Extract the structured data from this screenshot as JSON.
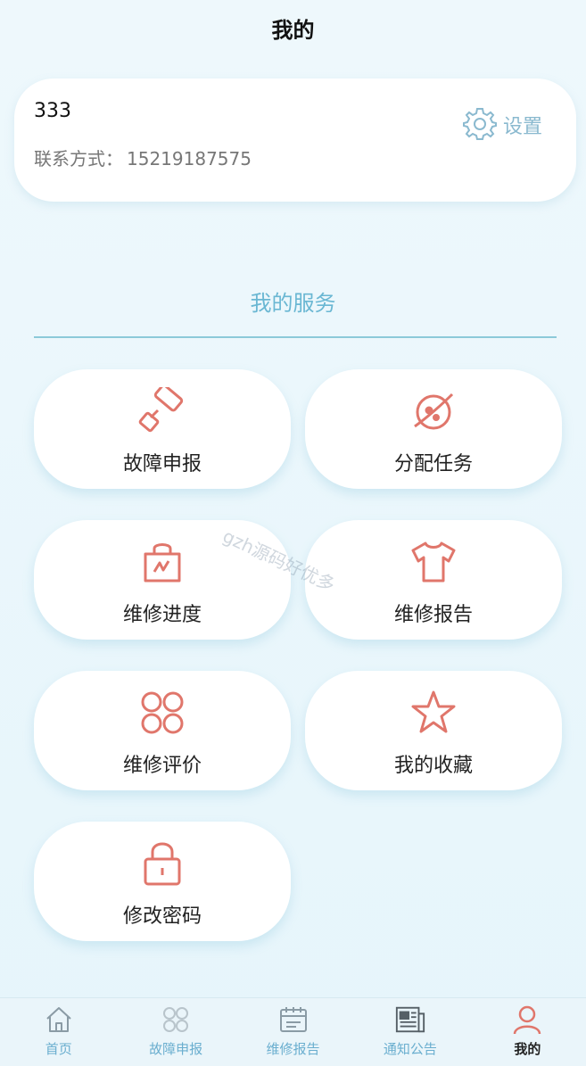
{
  "header": {
    "title": "我的"
  },
  "profile": {
    "name": "333",
    "contact_label": "联系方式：",
    "contact_value": "15219187575",
    "settings_label": "设置"
  },
  "section": {
    "title": "我的服务"
  },
  "services": [
    {
      "label": "故障申报",
      "icon": "paint-roller-icon"
    },
    {
      "label": "分配任务",
      "icon": "planet-icon"
    },
    {
      "label": "维修进度",
      "icon": "shopping-bag-icon"
    },
    {
      "label": "维修报告",
      "icon": "tshirt-icon"
    },
    {
      "label": "维修评价",
      "icon": "four-circles-icon"
    },
    {
      "label": "我的收藏",
      "icon": "star-icon"
    },
    {
      "label": "修改密码",
      "icon": "lock-icon"
    }
  ],
  "watermark": "gzh源码好优多",
  "tabbar": {
    "items": [
      {
        "label": "首页",
        "icon": "home-icon",
        "active": false
      },
      {
        "label": "故障申报",
        "icon": "grid-flower-icon",
        "active": false
      },
      {
        "label": "维修报告",
        "icon": "calendar-icon",
        "active": false
      },
      {
        "label": "通知公告",
        "icon": "newspaper-icon",
        "active": false
      },
      {
        "label": "我的",
        "icon": "user-icon",
        "active": true
      }
    ]
  },
  "colors": {
    "accent": "#6ab7d3",
    "icon_red": "#e0766b",
    "tab_active_icon": "#e0766b"
  }
}
